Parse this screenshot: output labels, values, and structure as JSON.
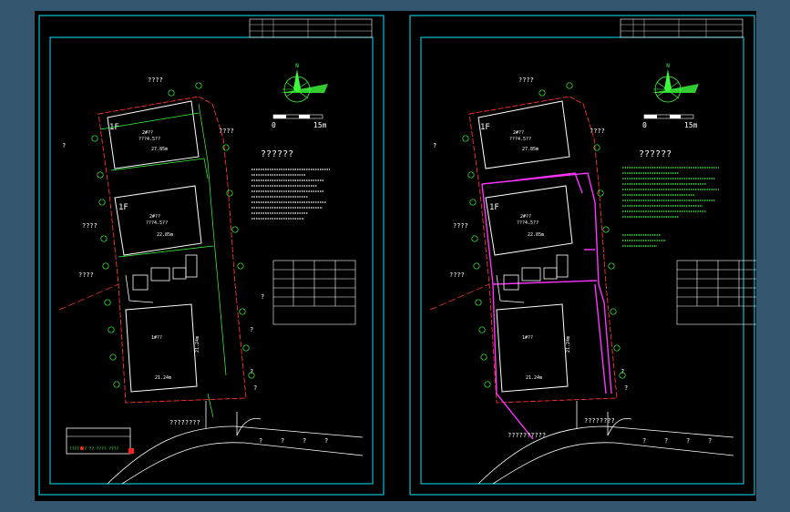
{
  "colors": {
    "background": "#35566f",
    "canvas": "#000000",
    "frame": "#00e5ff",
    "building": "#ffffff",
    "tree": "#3cff3c",
    "boundary": "#ff3030",
    "pipe": "#ff33ff"
  },
  "sheets": [
    {
      "id": "left",
      "title": "??????",
      "scale_zero": "0",
      "scale_end": "15m",
      "building_a": {
        "floor": "1F",
        "name": "2#??",
        "sub": "???4.5??",
        "dim": "27.85m"
      },
      "building_b": {
        "floor": "1F",
        "name": "2#??",
        "sub": "???4.5??",
        "dim": "22.85m"
      },
      "building_c": {
        "name": "1#??",
        "dim_h": "21.24m",
        "dim_w": "21.24m"
      },
      "labels_left": [
        "????",
        "?",
        "????",
        "?",
        "?",
        "????",
        "?",
        "?"
      ],
      "labels_right": [
        "????",
        "?",
        "????",
        "?",
        "?",
        "?"
      ],
      "road_label": "????????",
      "road_marks": [
        "?",
        "?",
        "?",
        "?"
      ],
      "stamp_line": "??????? ?? ???? ????"
    },
    {
      "id": "right",
      "title": "??????",
      "scale_zero": "0",
      "scale_end": "15m",
      "building_a": {
        "floor": "1F",
        "name": "2#??",
        "sub": "???4.5??",
        "dim": "27.85m"
      },
      "building_b": {
        "floor": "1F",
        "name": "2#??",
        "sub": "???4.5??",
        "dim": "22.85m"
      },
      "building_c": {
        "name": "1#??",
        "dim_h": "21.24m",
        "dim_w": "21.24m"
      },
      "labels_left": [
        "????",
        "?",
        "????",
        "?",
        "?",
        "????",
        "?",
        "?"
      ],
      "labels_right": [
        "????",
        "?",
        "????",
        "?",
        "?",
        "?"
      ],
      "road_label": "??????????",
      "road_label2": "????????",
      "road_marks": [
        "?",
        "?",
        "?",
        "?"
      ]
    }
  ]
}
